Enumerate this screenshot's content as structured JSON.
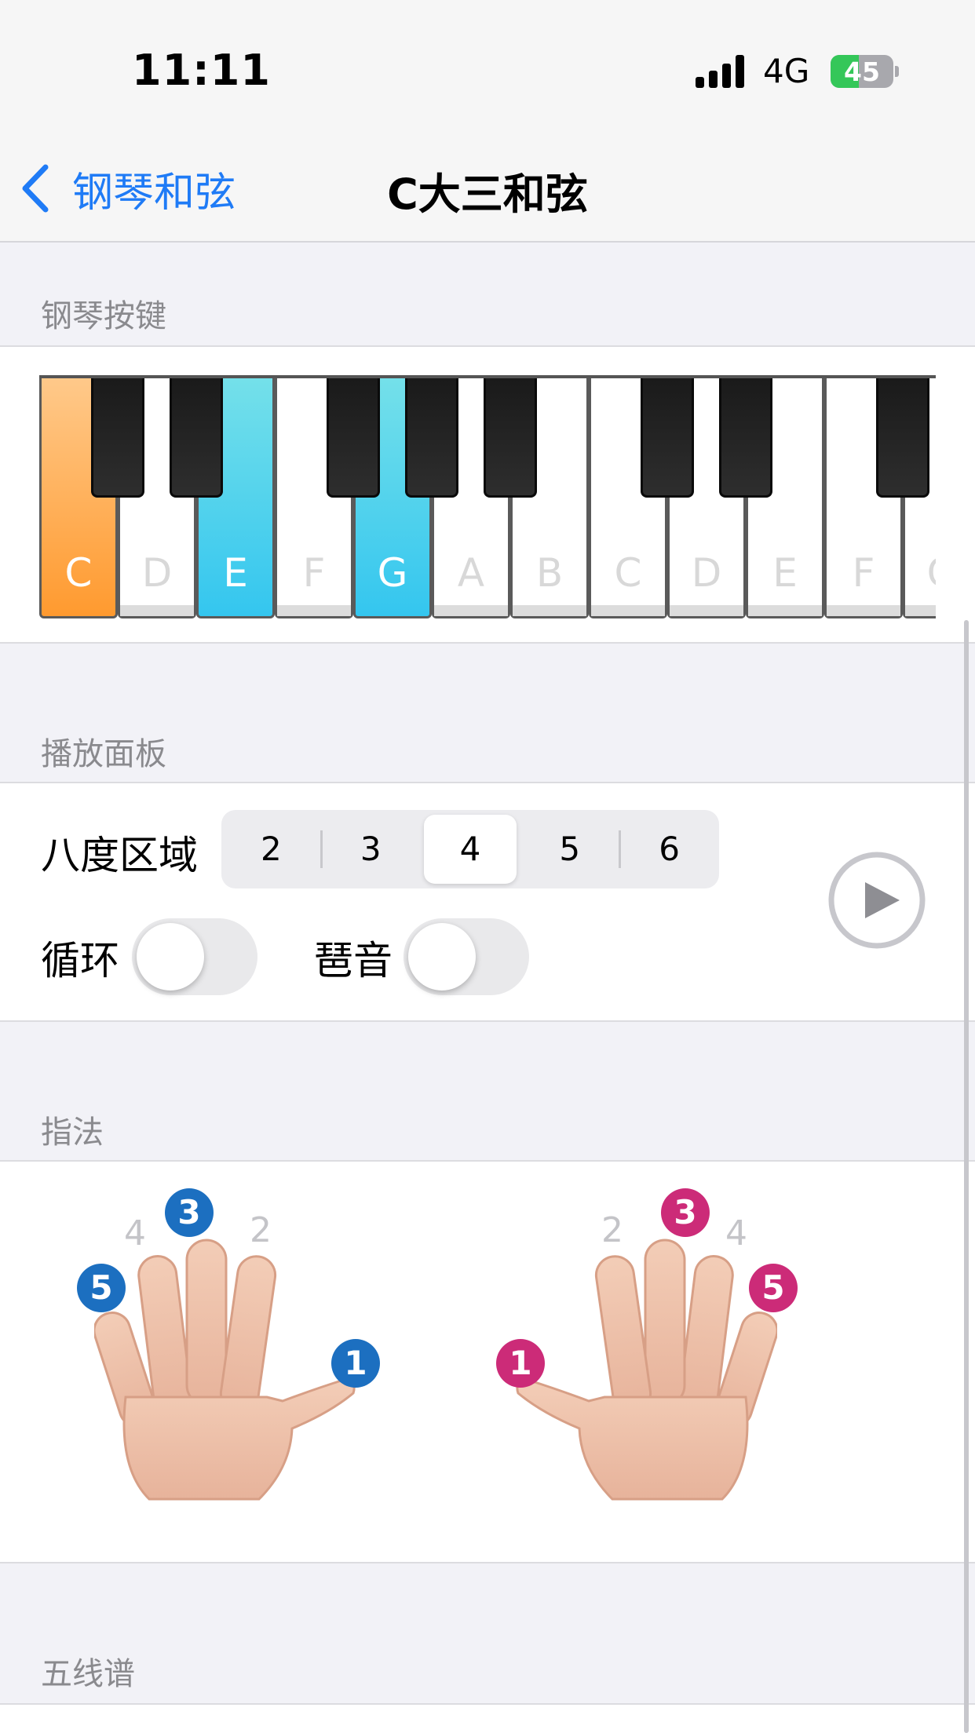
{
  "status": {
    "time": "11:11",
    "network": "4G",
    "battery": "45",
    "battery_level": 0.45
  },
  "nav": {
    "back_label": "钢琴和弦",
    "title": "C大三和弦"
  },
  "piano_section": {
    "header": "钢琴按键",
    "white_keys": [
      "C",
      "D",
      "E",
      "F",
      "G",
      "A",
      "B",
      "C",
      "D",
      "E",
      "F",
      "G"
    ]
  },
  "playback": {
    "header": "播放面板",
    "octave_label": "八度区域",
    "octaves": [
      "2",
      "3",
      "4",
      "5",
      "6"
    ],
    "selected_octave": "4",
    "loop_label": "循环",
    "loop_on": false,
    "arpeggio_label": "琶音",
    "arpeggio_on": false
  },
  "fingering": {
    "header": "指法",
    "left_hand": {
      "highlighted": [
        "5",
        "3",
        "1"
      ],
      "inactive": [
        "4",
        "2"
      ]
    },
    "right_hand": {
      "highlighted": [
        "1",
        "3",
        "5"
      ],
      "inactive": [
        "2",
        "4"
      ]
    }
  },
  "staff": {
    "header": "五线谱"
  },
  "colors": {
    "accent": "#1f7bf6",
    "root_key": "#ff9a2f",
    "chord_key": "#34c6ef",
    "left_badge": "#1c6fc0",
    "right_badge": "#cc2b78"
  }
}
